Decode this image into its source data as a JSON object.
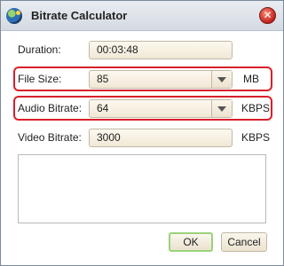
{
  "window": {
    "title": "Bitrate Calculator"
  },
  "form": {
    "duration": {
      "label": "Duration:",
      "value": "00:03:48"
    },
    "file_size": {
      "label": "File Size:",
      "value": "85",
      "unit": "MB"
    },
    "audio_bitrate": {
      "label": "Audio Bitrate:",
      "value": "64",
      "unit": "KBPS"
    },
    "video_bitrate": {
      "label": "Video Bitrate:",
      "value": "3000",
      "unit": "KBPS"
    }
  },
  "notes": {
    "value": ""
  },
  "buttons": {
    "ok": "OK",
    "cancel": "Cancel"
  },
  "icons": {
    "app": "bitrate-calculator-icon",
    "close": "close-icon",
    "dropdown": "chevron-down-icon"
  },
  "colors": {
    "highlight": "#d8202a",
    "ok_border": "#9ad27a"
  }
}
